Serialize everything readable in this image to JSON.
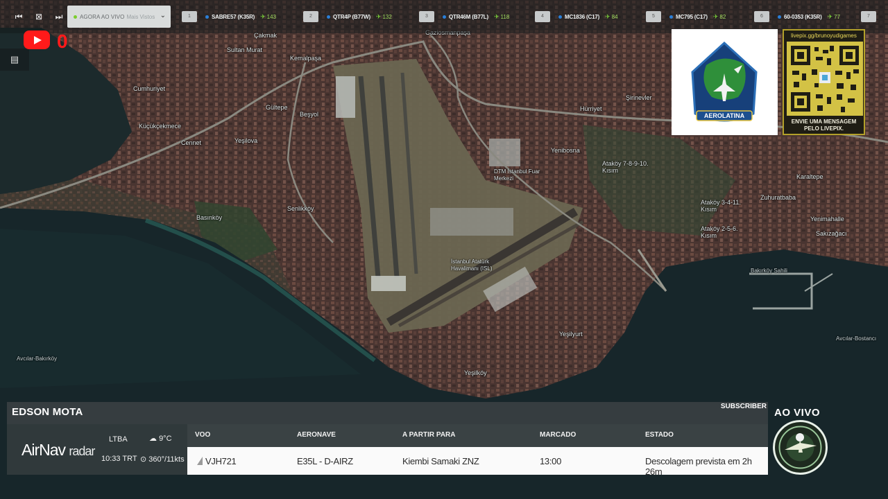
{
  "top_bar": {
    "nav_icons": [
      "first-page-icon",
      "fullscreen-exit-icon",
      "skip-next-icon"
    ],
    "mode": {
      "live_label": "AGORA AO VIVO",
      "sub_label": "Mais Vistos",
      "status_color": "#7ccd2e"
    },
    "flights": [
      {
        "index": "1",
        "callsign": "SABRE57 (K35R)",
        "count": "143"
      },
      {
        "index": "2",
        "callsign": "QTR4P (B77W)",
        "count": "132"
      },
      {
        "index": "3",
        "callsign": "QTR46M (B77L)",
        "count": "118"
      },
      {
        "index": "4",
        "callsign": "MC1836 (C17)",
        "count": "84"
      },
      {
        "index": "5",
        "callsign": "MC795 (C17)",
        "count": "82"
      },
      {
        "index": "6",
        "callsign": "60-0353 (K35R)",
        "count": "77"
      },
      {
        "index": "7",
        "callsign": "",
        "count": ""
      }
    ]
  },
  "youtube": {
    "count": "0",
    "color": "#ff1a1a"
  },
  "sponsor": {
    "name": "AEROLATINA"
  },
  "qr_card": {
    "url": "livepix.gg/brunoyudigames",
    "message_line1": "ENVIE UMA MENSAGEM",
    "message_line2": "PELO LIVEPIX."
  },
  "map": {
    "labels": [
      "Çakmak",
      "Gaziosmanpaşa",
      "Sultan Murat",
      "Kemalpaşa",
      "Cumhuriyet",
      "Gültepe",
      "Beşyol",
      "Küçükçekmece",
      "Cennet",
      "Yeşilova",
      "Şirinevler",
      "Hürriyet",
      "Yenibosna",
      "Ataköy 7-8-9-10. Kısım",
      "DTM İstanbul Fuar Merkezi",
      "Karaltepe",
      "Zuhuratbaba",
      "Ataköy 3-4-11. Kısım",
      "Ataköy 2-5-6. Kısım",
      "Yenimahalle",
      "Sakızağacı",
      "Senlikköy",
      "Basınköy",
      "İstanbul Atatürk Havalimanı (ISL)",
      "Yeşilyurt",
      "Yeşilköy",
      "Avcılar-Bakırköy",
      "Avcılar-Bostancı",
      "Bakırköy Sahili"
    ]
  },
  "flight_panel": {
    "pilot_name": "EDSON MOTA",
    "subscriber_label": "SUBSCRIBER",
    "brand": {
      "name": "AirNav",
      "suffix": "radar"
    },
    "airport": {
      "icao": "LTBA",
      "local_time": "10:33 TRT",
      "temperature": "9°C",
      "wind": "360°/11kts"
    },
    "columns": [
      "VOO",
      "AERONAVE",
      "A PARTIR PARA",
      "MARCADO",
      "ESTADO"
    ],
    "row": {
      "flight": "VJH721",
      "aircraft": "E35L - D-AIRZ",
      "destination": "Kiembi Samaki ZNZ",
      "scheduled": "13:00",
      "status": "Descolagem prevista em 2h 26m"
    }
  },
  "live_badge": {
    "label": "AO VIVO"
  }
}
